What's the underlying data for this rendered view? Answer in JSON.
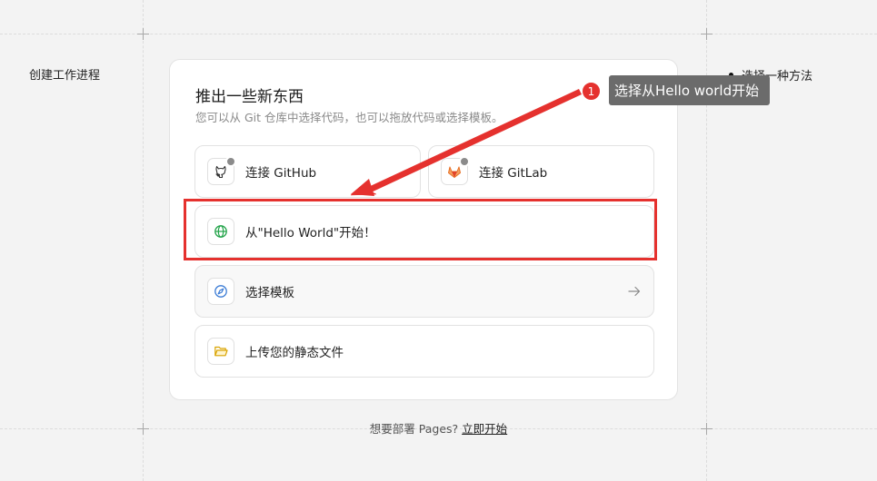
{
  "sidebar": {
    "title": "创建工作进程"
  },
  "steps": {
    "method_label": "选择一种方法"
  },
  "card": {
    "title": "推出一些新东西",
    "subtitle": "您可以从 Git 仓库中选择代码，也可以拖放代码或选择模板。",
    "options": {
      "github": {
        "label": "连接 GitHub",
        "icon": "github-icon"
      },
      "gitlab": {
        "label": "连接 GitLab",
        "icon": "gitlab-icon"
      },
      "hello_world": {
        "label": "从\"Hello World\"开始！",
        "icon": "globe-icon"
      },
      "template": {
        "label": "选择模板",
        "icon": "compass-icon"
      },
      "upload": {
        "label": "上传您的静态文件",
        "icon": "folder-icon"
      }
    }
  },
  "footer": {
    "prompt": "想要部署 Pages?",
    "link": "立即开始"
  },
  "annotation": {
    "step_number": "1",
    "tooltip": "选择从Hello world开始",
    "color": "#e5312e"
  }
}
